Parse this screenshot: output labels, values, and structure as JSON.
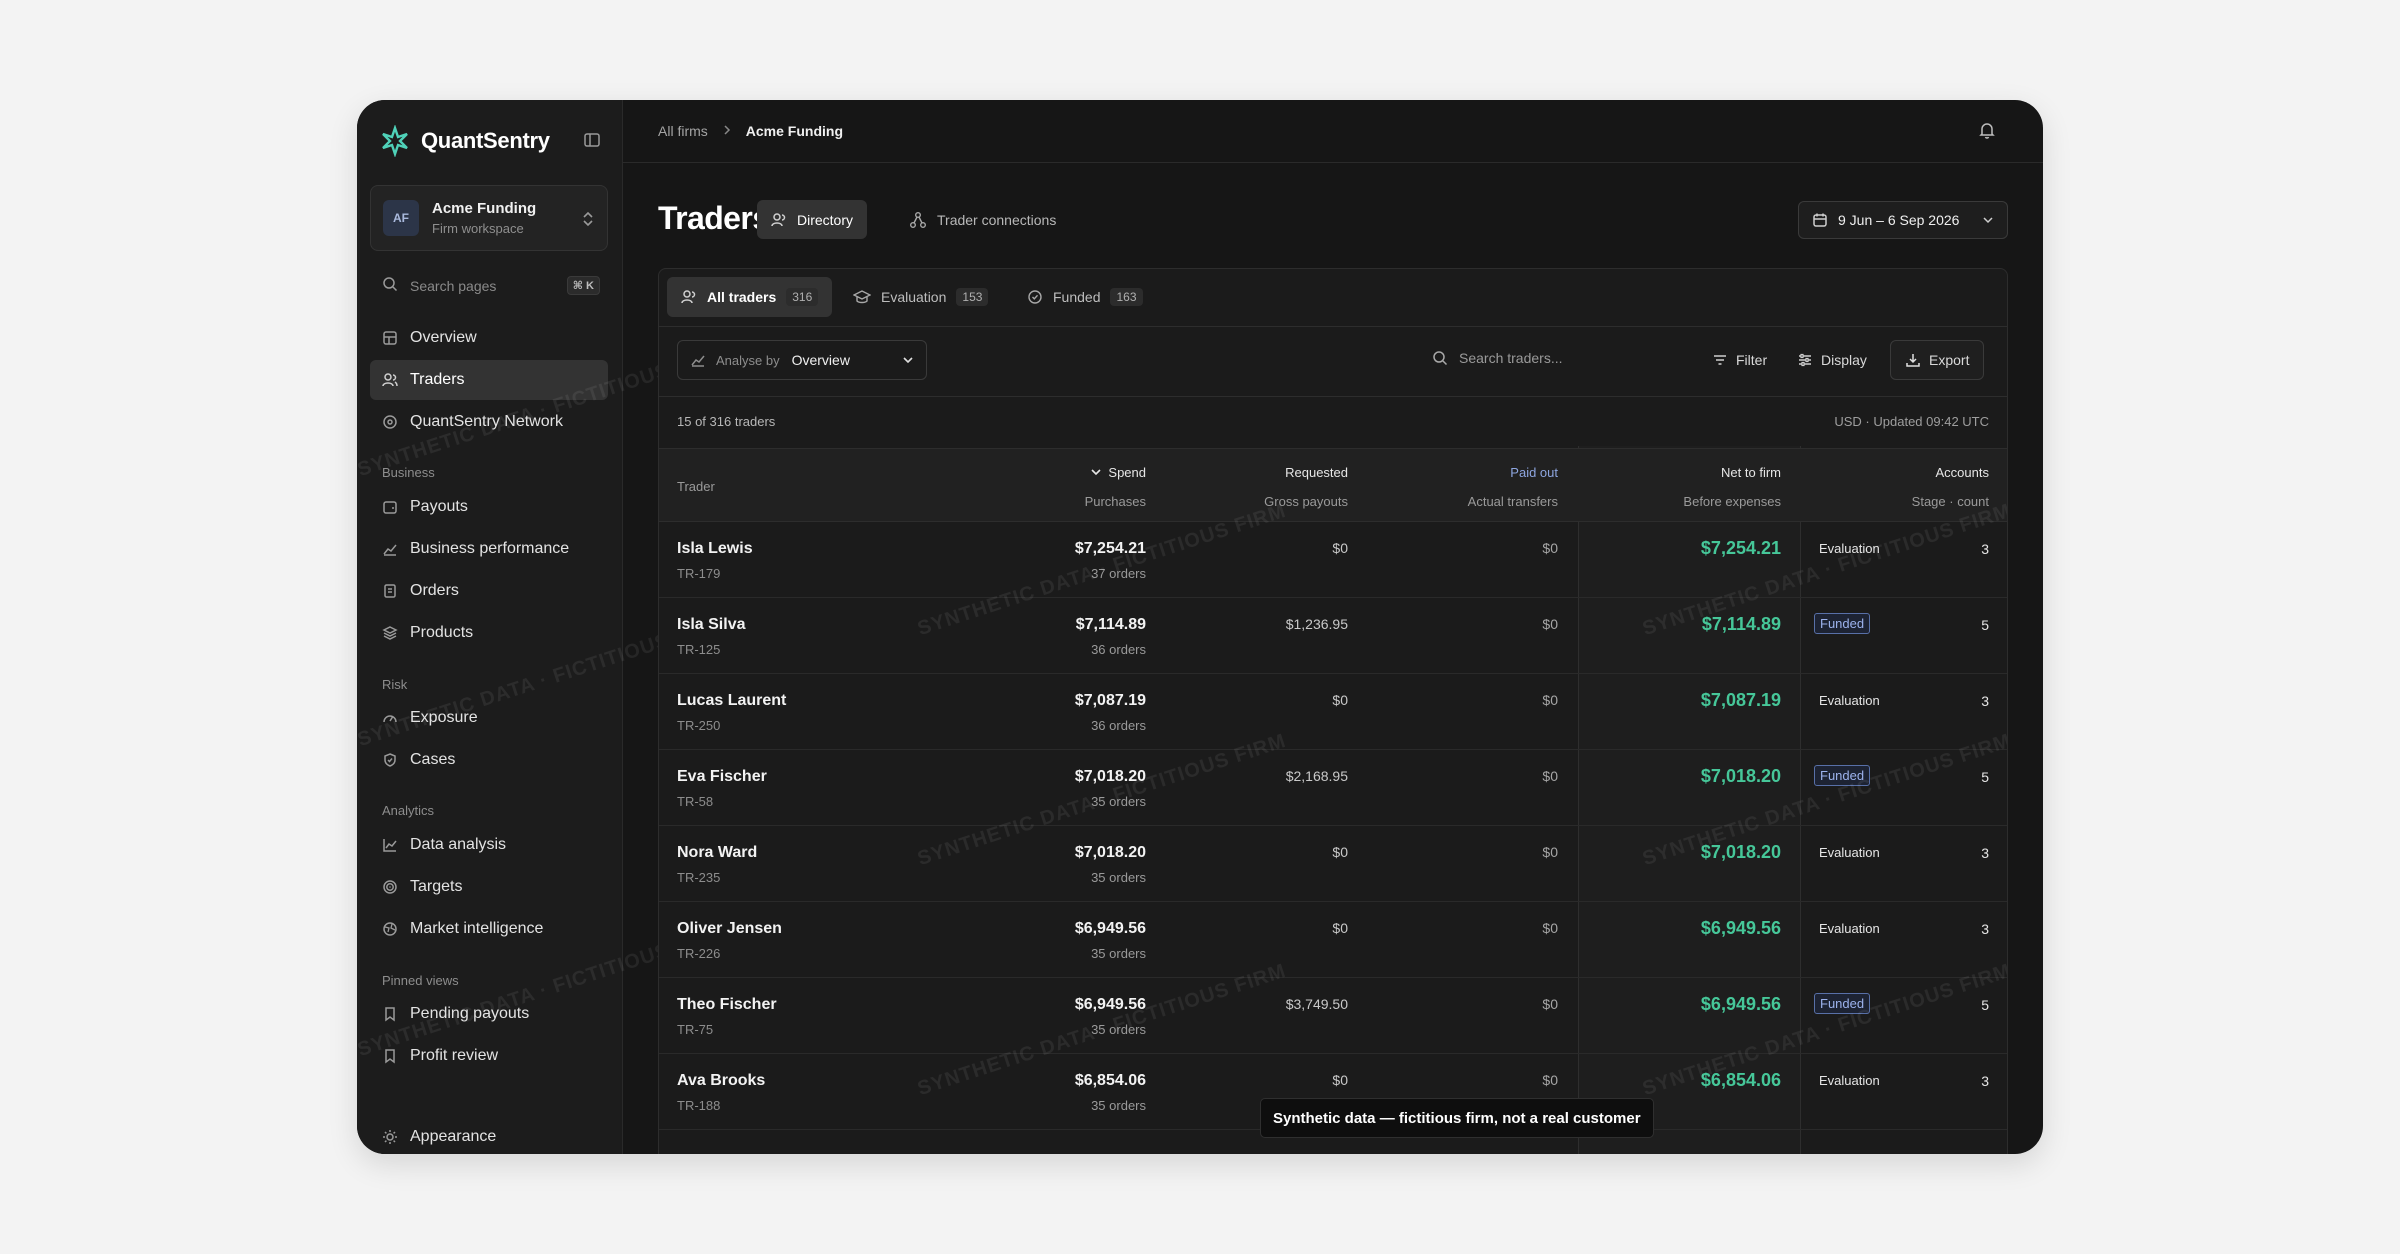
{
  "brand": {
    "name": "QuantSentry"
  },
  "workspace": {
    "initials": "AF",
    "name": "Acme Funding",
    "subtitle": "Firm workspace"
  },
  "search_pages": {
    "placeholder": "Search pages",
    "shortcut": "⌘ K"
  },
  "nav": {
    "overview": "Overview",
    "traders": "Traders",
    "network": "QuantSentry Network",
    "section_business": "Business",
    "payouts": "Payouts",
    "business_performance": "Business performance",
    "orders": "Orders",
    "products": "Products",
    "section_risk": "Risk",
    "exposure": "Exposure",
    "cases": "Cases",
    "section_analytics": "Analytics",
    "data_analysis": "Data analysis",
    "targets": "Targets",
    "market_intelligence": "Market intelligence",
    "section_pinned": "Pinned views",
    "pending_payouts": "Pending payouts",
    "profit_review": "Profit review",
    "appearance": "Appearance"
  },
  "breadcrumb": {
    "root": "All firms",
    "current": "Acme Funding"
  },
  "page": {
    "title": "Traders"
  },
  "view_tabs": {
    "directory": "Directory",
    "connections": "Trader connections"
  },
  "date_range": "9 Jun – 6 Sep 2026",
  "segments": {
    "all": {
      "label": "All traders",
      "count": "316"
    },
    "evaluation": {
      "label": "Evaluation",
      "count": "153"
    },
    "funded": {
      "label": "Funded",
      "count": "163"
    }
  },
  "toolbar": {
    "analyse_prefix": "Analyse by",
    "analyse_value": "Overview",
    "search_placeholder": "Search traders...",
    "filter": "Filter",
    "display": "Display",
    "export": "Export"
  },
  "meta": {
    "count": "15 of 316 traders",
    "updated": "USD · Updated 09:42 UTC"
  },
  "columns": {
    "trader": "Trader",
    "spend": "Spend",
    "spend_sub": "Purchases",
    "requested": "Requested",
    "requested_sub": "Gross payouts",
    "paid": "Paid out",
    "paid_sub": "Actual transfers",
    "net": "Net to firm",
    "net_sub": "Before expenses",
    "accounts": "Accounts",
    "accounts_sub": "Stage · count"
  },
  "rows": [
    {
      "name": "Isla Lewis",
      "id": "TR-179",
      "spend": "$7,254.21",
      "orders": "37 orders",
      "requested": "$0",
      "paid": "$0",
      "net": "$7,254.21",
      "stage": "Evaluation",
      "count": "3"
    },
    {
      "name": "Isla Silva",
      "id": "TR-125",
      "spend": "$7,114.89",
      "orders": "36 orders",
      "requested": "$1,236.95",
      "paid": "$0",
      "net": "$7,114.89",
      "stage": "Funded",
      "count": "5"
    },
    {
      "name": "Lucas Laurent",
      "id": "TR-250",
      "spend": "$7,087.19",
      "orders": "36 orders",
      "requested": "$0",
      "paid": "$0",
      "net": "$7,087.19",
      "stage": "Evaluation",
      "count": "3"
    },
    {
      "name": "Eva Fischer",
      "id": "TR-58",
      "spend": "$7,018.20",
      "orders": "35 orders",
      "requested": "$2,168.95",
      "paid": "$0",
      "net": "$7,018.20",
      "stage": "Funded",
      "count": "5"
    },
    {
      "name": "Nora Ward",
      "id": "TR-235",
      "spend": "$7,018.20",
      "orders": "35 orders",
      "requested": "$0",
      "paid": "$0",
      "net": "$7,018.20",
      "stage": "Evaluation",
      "count": "3"
    },
    {
      "name": "Oliver Jensen",
      "id": "TR-226",
      "spend": "$6,949.56",
      "orders": "35 orders",
      "requested": "$0",
      "paid": "$0",
      "net": "$6,949.56",
      "stage": "Evaluation",
      "count": "3"
    },
    {
      "name": "Theo Fischer",
      "id": "TR-75",
      "spend": "$6,949.56",
      "orders": "35 orders",
      "requested": "$3,749.50",
      "paid": "$0",
      "net": "$6,949.56",
      "stage": "Funded",
      "count": "5"
    },
    {
      "name": "Ava Brooks",
      "id": "TR-188",
      "spend": "$6,854.06",
      "orders": "35 orders",
      "requested": "$0",
      "paid": "$0",
      "net": "$6,854.06",
      "stage": "Evaluation",
      "count": "3"
    }
  ],
  "watermark": "SYNTHETIC DATA · FICTITIOUS FIRM",
  "toast": "Synthetic data — fictitious firm, not a real customer",
  "colors": {
    "accent_green": "#46c799",
    "funded_badge": "#9cb2ec",
    "brand_teal": "#4fd1b8"
  }
}
